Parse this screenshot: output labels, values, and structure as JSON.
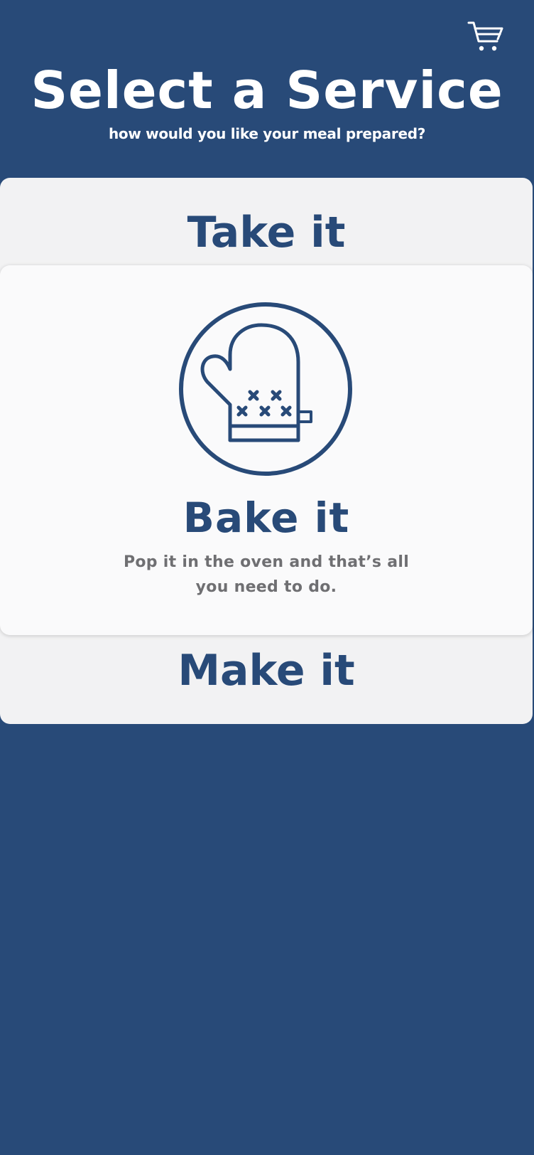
{
  "header": {
    "title": "Select a Service",
    "subtitle": "how would you like your meal prepared?"
  },
  "cart": {
    "icon": "shopping-cart-icon"
  },
  "services": {
    "take": {
      "label": "Take it"
    },
    "bake": {
      "label": "Bake it",
      "description": "Pop it in the oven and that’s all you need to do.",
      "icon": "oven-mitt-icon"
    },
    "make": {
      "label": "Make it"
    }
  },
  "colors": {
    "background": "#284a78",
    "accent": "#284a78",
    "panel": "#f2f2f3",
    "card": "#fafafb",
    "description_text": "#6f6f72"
  }
}
